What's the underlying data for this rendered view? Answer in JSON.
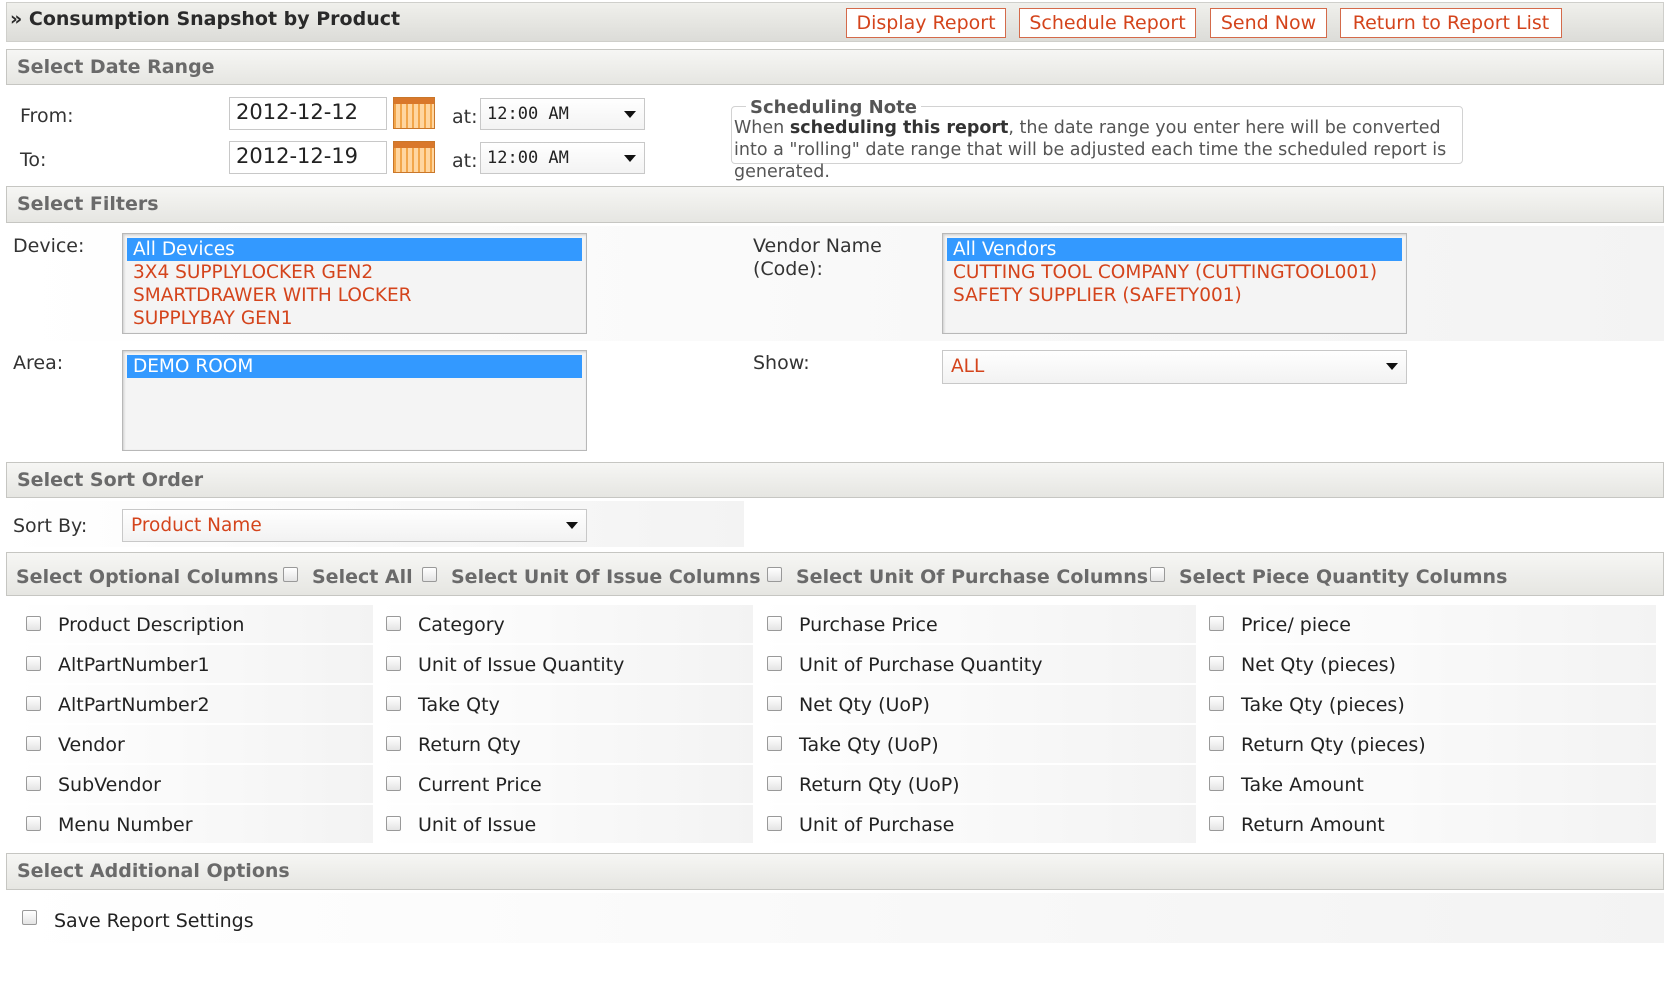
{
  "header": {
    "title": "Consumption Snapshot by Product",
    "buttons": [
      "Display Report",
      "Schedule Report",
      "Send Now",
      "Return to Report List"
    ]
  },
  "date_range": {
    "section_title": "Select Date Range",
    "from_label": "From:",
    "from_value": "2012-12-12",
    "to_label": "To:",
    "to_value": "2012-12-19",
    "at_label": "at:",
    "from_time": "12:00 AM",
    "to_time": "12:00 AM"
  },
  "note": {
    "legend": "Scheduling Note",
    "pre": "When ",
    "bold": "scheduling this report",
    "post": ", the date range you enter here will be converted into a \"rolling\" date range that will be adjusted each time the scheduled report is generated."
  },
  "filters": {
    "section_title": "Select Filters",
    "device_label": "Device:",
    "devices": [
      "All Devices",
      "3X4 SUPPLYLOCKER GEN2",
      "SMARTDRAWER WITH LOCKER",
      "SUPPLYBAY GEN1"
    ],
    "vendor_label_1": "Vendor Name",
    "vendor_label_2": "(Code):",
    "vendors": [
      "All Vendors",
      "CUTTING TOOL COMPANY (CUTTINGTOOL001)",
      "SAFETY SUPPLIER (SAFETY001)"
    ],
    "area_label": "Area:",
    "areas": [
      "DEMO ROOM"
    ],
    "show_label": "Show:",
    "show_value": "ALL"
  },
  "sort": {
    "section_title": "Select Sort Order",
    "label": "Sort By:",
    "value": "Product Name"
  },
  "optional": {
    "section_title": "Select Optional Columns",
    "group_toggles": [
      "Select All",
      "Select Unit Of Issue Columns",
      "Select Unit Of Purchase Columns",
      "Select Piece Quantity Columns"
    ],
    "columns": [
      [
        "Product Description",
        "AltPartNumber1",
        "AltPartNumber2",
        "Vendor",
        "SubVendor",
        "Menu Number"
      ],
      [
        "Category",
        "Unit of Issue Quantity",
        "Take Qty",
        "Return Qty",
        "Current Price",
        "Unit of Issue"
      ],
      [
        "Purchase Price",
        "Unit of Purchase Quantity",
        "Net Qty (UoP)",
        "Take Qty (UoP)",
        "Return Qty (UoP)",
        "Unit of Purchase"
      ],
      [
        "Price/ piece",
        "Net Qty (pieces)",
        "Take Qty (pieces)",
        "Return Qty (pieces)",
        "Take Amount",
        "Return Amount"
      ]
    ]
  },
  "additional": {
    "section_title": "Select Additional Options",
    "save_label": "Save Report Settings"
  }
}
